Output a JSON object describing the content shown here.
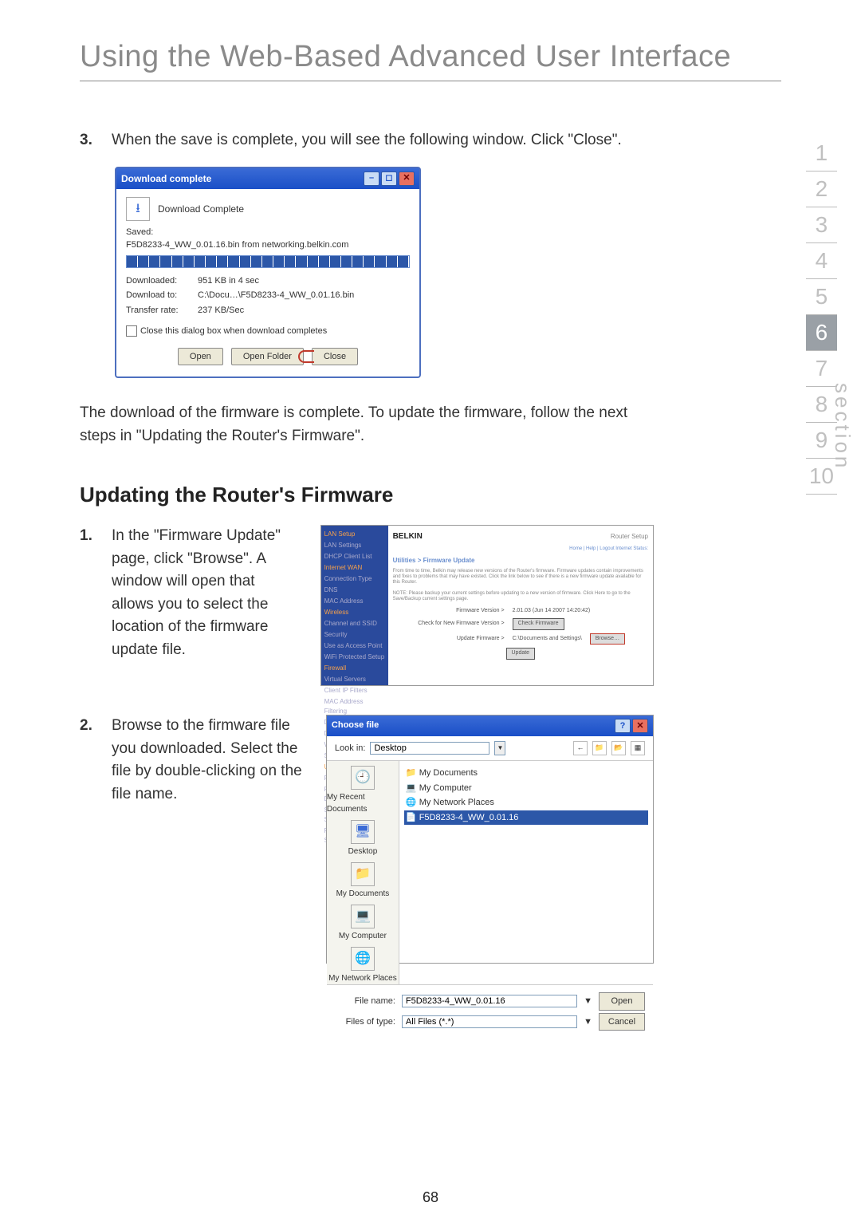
{
  "page_title": "Using the Web-Based Advanced User Interface",
  "section_label": "section",
  "section_numbers": [
    "1",
    "2",
    "3",
    "4",
    "5",
    "6",
    "7",
    "8",
    "9",
    "10"
  ],
  "active_section_index": 5,
  "step3": {
    "num": "3.",
    "text": "When the save is complete, you will see the following window. Click \"Close\"."
  },
  "dialog": {
    "title": "Download complete",
    "status_label": "Download Complete",
    "saved_label": "Saved:",
    "saved_value": "F5D8233-4_WW_0.01.16.bin from networking.belkin.com",
    "downloaded_label": "Downloaded:",
    "downloaded_value": "951 KB in 4 sec",
    "downloadto_label": "Download to:",
    "downloadto_value": "C:\\Docu…\\F5D8233-4_WW_0.01.16.bin",
    "rate_label": "Transfer rate:",
    "rate_value": "237 KB/Sec",
    "checkbox_label": "Close this dialog box when download completes",
    "btn_open": "Open",
    "btn_open_folder": "Open Folder",
    "btn_close": "Close"
  },
  "after_dialog": "The download of the firmware is complete. To update the firmware, follow the next steps in \"Updating the Router's Firmware\".",
  "subhead": "Updating the Router's Firmware",
  "step1": {
    "num": "1.",
    "text": "In the \"Firmware Update\" page, click \"Browse\". A window will open that allows you to select the location of the firmware update file."
  },
  "fig1": {
    "logo": "BELKIN",
    "header": "Router Setup",
    "links": "Home | Help | Logout   Internet Status:",
    "crumb": "Utilities > Firmware Update",
    "note1": "From time to time, Belkin may release new versions of the Router's firmware. Firmware updates contain improvements and fixes to problems that may have existed. Click the link below to see if there is a new firmware update available for this Router.",
    "note2": "NOTE: Please backup your current settings before updating to a new version of firmware. Click Here to go to the Save/Backup current settings page.",
    "row1_label": "Firmware Version >",
    "row1_value": "2.01.03 (Jun 14 2007 14:20:42)",
    "row2_label": "Check for New Firmware Version >",
    "row2_btn": "Check Firmware",
    "row3_label": "Update Firmware >",
    "row3_value": "C:\\Documents and Settings\\",
    "row3_btn": "Browse…",
    "update_btn": "Update",
    "side_items": [
      "LAN Setup",
      "LAN Settings",
      "DHCP Client List",
      "Internet WAN",
      "Connection Type",
      "DNS",
      "MAC Address",
      "Wireless",
      "Channel and SSID",
      "Security",
      "Use as Access Point",
      "WiFi Protected Setup",
      "Firewall",
      "Virtual Servers",
      "Client IP Filters",
      "MAC Address Filtering",
      "DMZ",
      "DDNS",
      "WAN Ping Blocking",
      "Security Log",
      "Utilities",
      "Restart Router",
      "Restore Factory Defaults",
      "Save/Backup Settings",
      "Restore Previous Settings"
    ]
  },
  "step2": {
    "num": "2.",
    "text": "Browse to the firmware file you downloaded. Select the file by double-clicking on the file name."
  },
  "fig2": {
    "title": "Choose file",
    "lookin_label": "Look in:",
    "lookin_value": "Desktop",
    "shortcuts": [
      "My Recent Documents",
      "Desktop",
      "My Documents",
      "My Computer",
      "My Network Places"
    ],
    "file_items": [
      "My Documents",
      "My Computer",
      "My Network Places"
    ],
    "file_selected": "F5D8233-4_WW_0.01.16",
    "filename_label": "File name:",
    "filename_value": "F5D8233-4_WW_0.01.16",
    "filetype_label": "Files of type:",
    "filetype_value": "All Files (*.*)",
    "btn_open": "Open",
    "btn_cancel": "Cancel"
  },
  "page_number": "68"
}
